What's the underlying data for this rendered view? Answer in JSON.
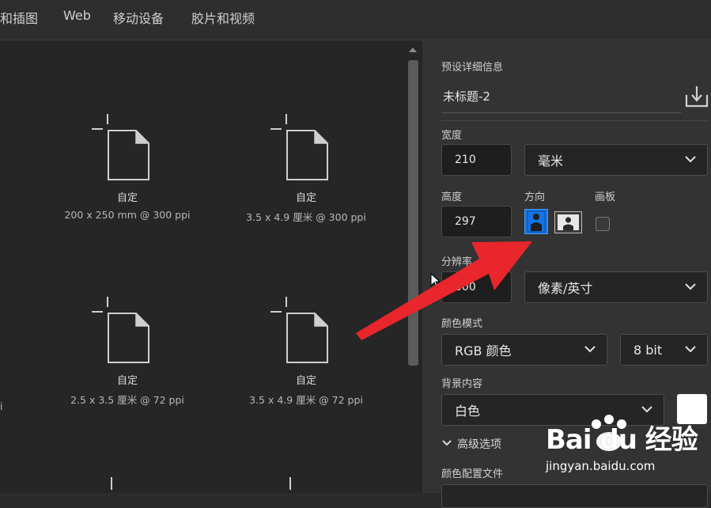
{
  "topnav": {
    "tabs": [
      "和插图",
      "Web",
      "移动设备",
      "胶片和视频"
    ]
  },
  "presets": [
    {
      "title": "自定",
      "subtitle": "200 x 250 mm @ 300 ppi"
    },
    {
      "title": "自定",
      "subtitle": "3.5 x 4.9 厘米 @ 300 ppi"
    },
    {
      "title": "自定",
      "subtitle": "2.5 x 3.5 厘米 @ 72 ppi"
    },
    {
      "title": "自定",
      "subtitle": "3.5 x 4.9 厘米 @ 72 ppi"
    }
  ],
  "left_edge_text": "i",
  "details": {
    "section_title": "预设详细信息",
    "doc_name": "未标题-2",
    "width_label": "宽度",
    "width_value": "210",
    "width_unit": "毫米",
    "height_label": "高度",
    "height_value": "297",
    "orientation_label": "方向",
    "artboard_label": "画板",
    "resolution_label": "分辨率",
    "resolution_value": "300",
    "resolution_unit": "像素/英寸",
    "color_mode_label": "颜色模式",
    "color_mode_value": "RGB 颜色",
    "bit_depth_value": "8 bit",
    "background_label": "背景内容",
    "background_value": "白色",
    "advanced_label": "高级选项",
    "color_profile_label": "颜色配置文件"
  },
  "colors": {
    "accent": "#1473e6",
    "annotation_arrow": "#e8262b",
    "swatch": "#ffffff"
  },
  "watermark": {
    "brand": "Bai du 经验",
    "url": "jingyan.baidu.com"
  }
}
